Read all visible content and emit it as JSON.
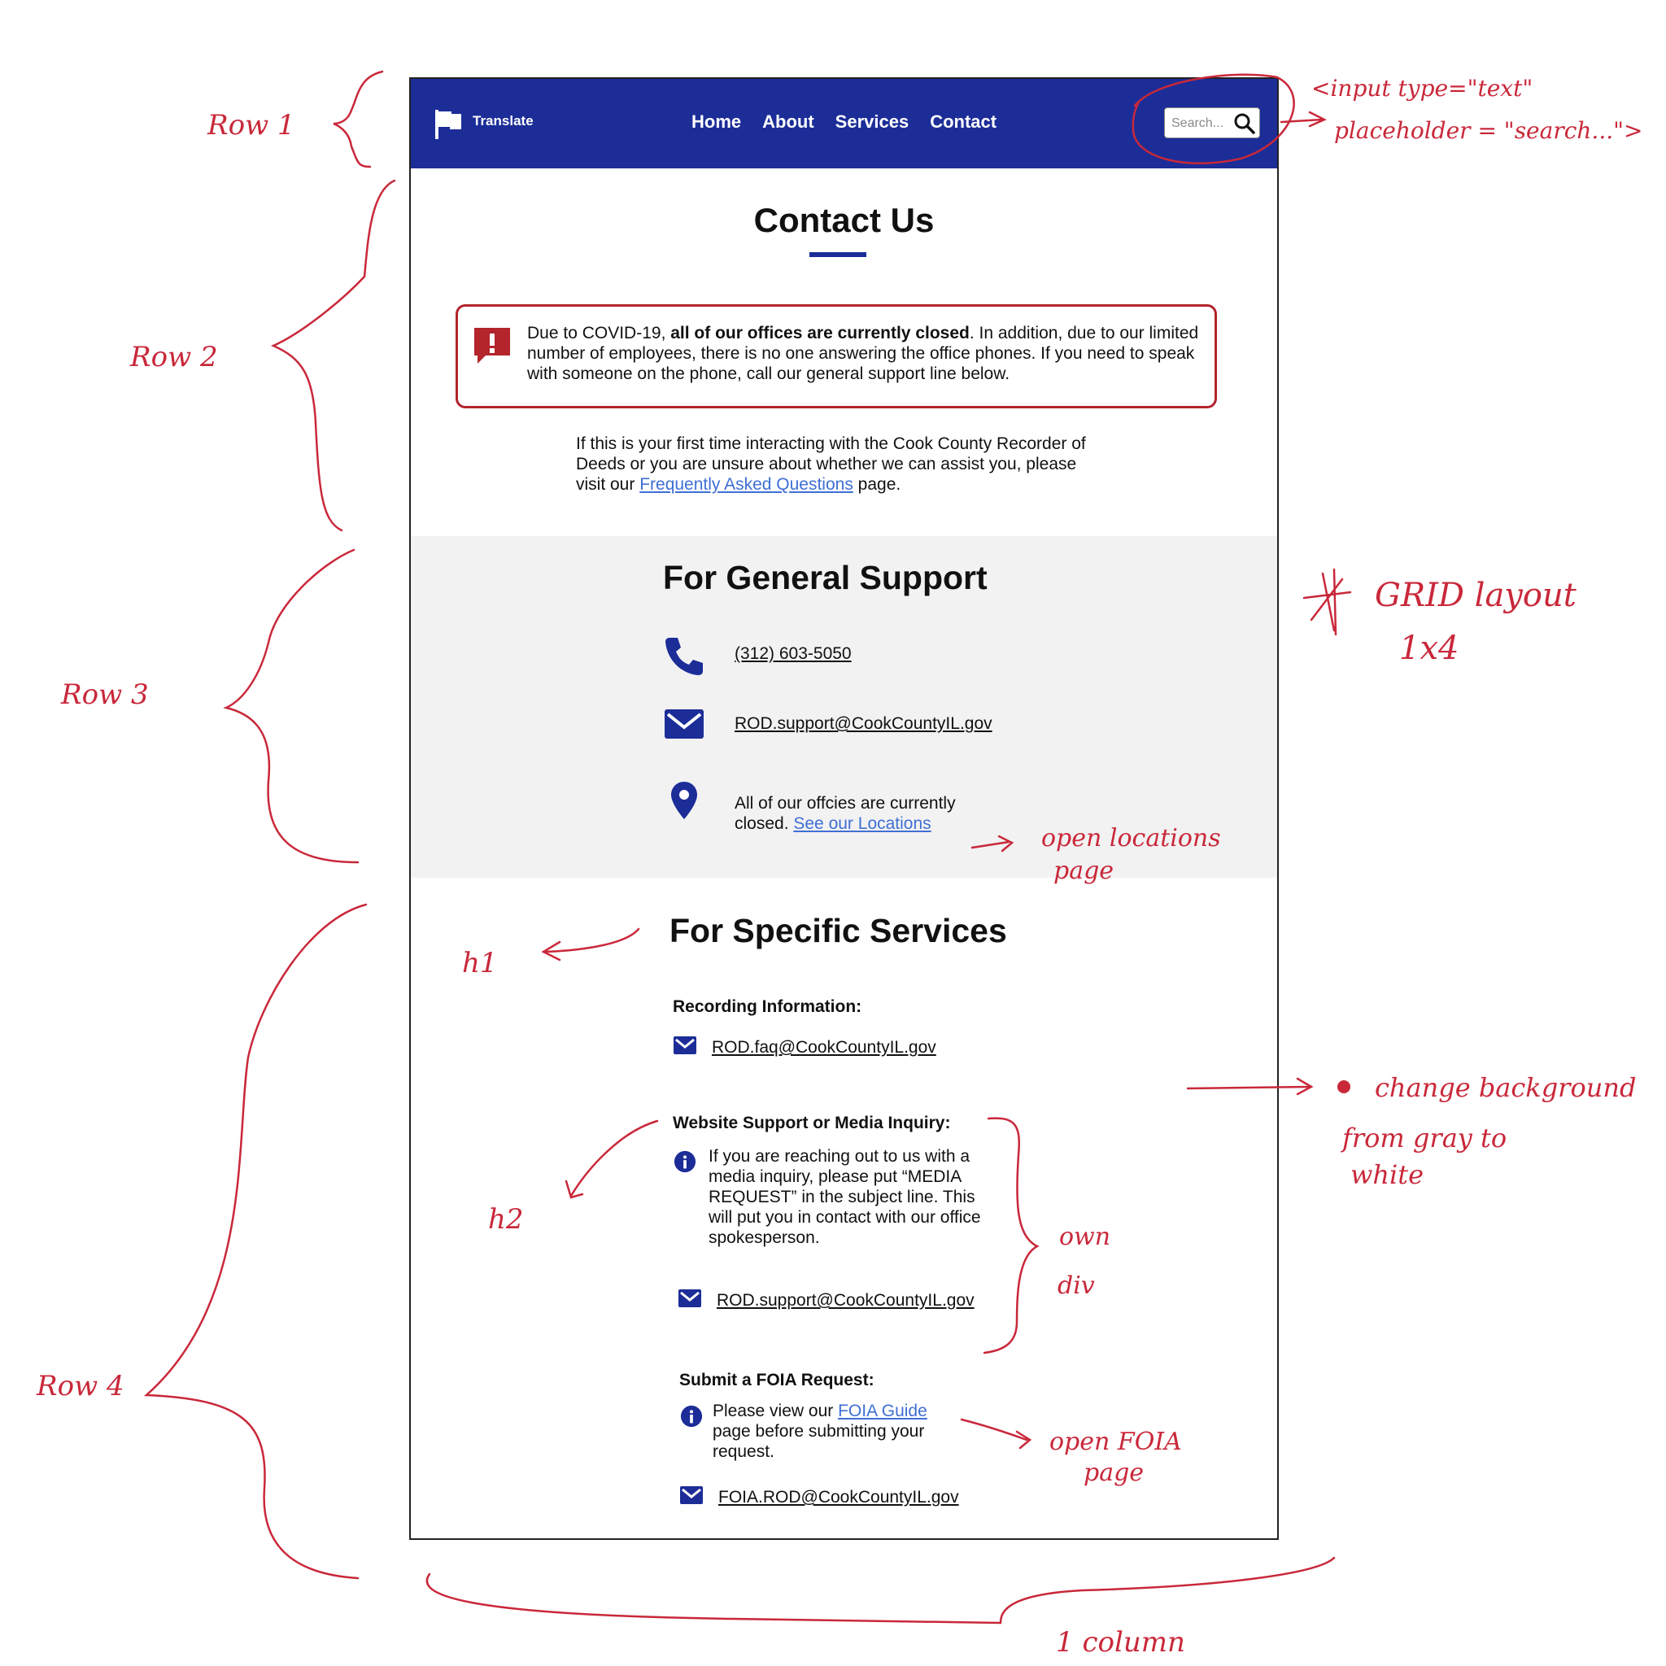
{
  "navbar": {
    "translate_label": "Translate",
    "links": [
      "Home",
      "About",
      "Services",
      "Contact"
    ],
    "search_placeholder": "Search..."
  },
  "page": {
    "title": "Contact Us",
    "alert": {
      "prefix": "Due to COVID-19, ",
      "bold": "all of our offices are currently closed",
      "suffix": ". In addition, due to our limited number of employees, there is no one answering the office phones. If you need to speak with someone on the phone, call our general support line below."
    },
    "intro": {
      "prefix": "If this is your first time interacting with the Cook County Recorder of Deeds or you are unsure about whether we can assist you, please visit our ",
      "link": "Frequently Asked Questions",
      "suffix": " page."
    }
  },
  "general_support": {
    "heading": "For General Support",
    "phone": "(312) 603-5050",
    "email": "ROD.support@CookCountyIL.gov",
    "location_text": "All of our offcies are currently closed. ",
    "location_link": "See our Locations"
  },
  "specific_services": {
    "heading": "For Specific Services",
    "recording": {
      "heading": "Recording Information:",
      "email": "ROD.faq@CookCountyIL.gov"
    },
    "website": {
      "heading": "Website Support or Media Inquiry:",
      "info": "If you are reaching out to us with a media inquiry, please put “MEDIA REQUEST” in the subject line. This will put you in contact with our office spokesperson.",
      "email": "ROD.support@CookCountyIL.gov"
    },
    "foia": {
      "heading": "Submit a FOIA Request:",
      "info_prefix": "Please view our ",
      "info_link": "FOIA Guide",
      "info_suffix": " page before submitting your request.",
      "email": "FOIA.ROD@CookCountyIL.gov"
    }
  },
  "annotations": {
    "row1": "Row 1",
    "row2": "Row 2",
    "row3": "Row 3",
    "row4": "Row 4",
    "input_note_line1": "<input type=\"text\"",
    "input_note_line2": "placeholder = \"search...\">",
    "grid_note_line1": "GRID layout",
    "grid_note_line2": "1x4",
    "locations_note_line1": "open locations",
    "locations_note_line2": "page",
    "h1_note": "h1",
    "h2_note": "h2",
    "background_note_line1": "change background",
    "background_note_line2": "from gray to",
    "background_note_line3": "white",
    "div_note_line1": "own",
    "div_note_line2": "div",
    "foia_note_line1": "open FOIA",
    "foia_note_line2": "page",
    "column_note": "1 column"
  },
  "colors": {
    "navbar": "#1c2d98",
    "icon_blue": "#1c2d98",
    "alert_red": "#b3242b",
    "link": "#3f6fd4",
    "section_gray": "#f2f2f2",
    "annotation_red": "#c9283a"
  }
}
